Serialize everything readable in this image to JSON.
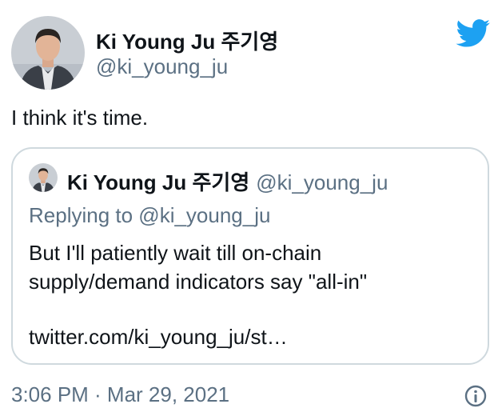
{
  "author": {
    "name": "Ki Young Ju 주기영",
    "handle": "@ki_young_ju"
  },
  "tweet": {
    "text": "I think it's time."
  },
  "quoted_tweet": {
    "name": "Ki Young Ju 주기영",
    "handle": "@ki_young_ju",
    "replying_to": "Replying to @ki_young_ju",
    "body_line_1": "But I'll patiently wait till on-chain",
    "body_line_2": "supply/demand indicators say \"all-in\"",
    "link": "twitter.com/ki_young_ju/st…"
  },
  "meta": {
    "timestamp": "3:06 PM · Mar 29, 2021"
  },
  "icons": {
    "brand": "twitter-bird-icon",
    "info": "info-icon"
  },
  "colors": {
    "brand_blue": "#1da1f2",
    "secondary_text": "#5b7083",
    "border": "#cfd9de"
  }
}
